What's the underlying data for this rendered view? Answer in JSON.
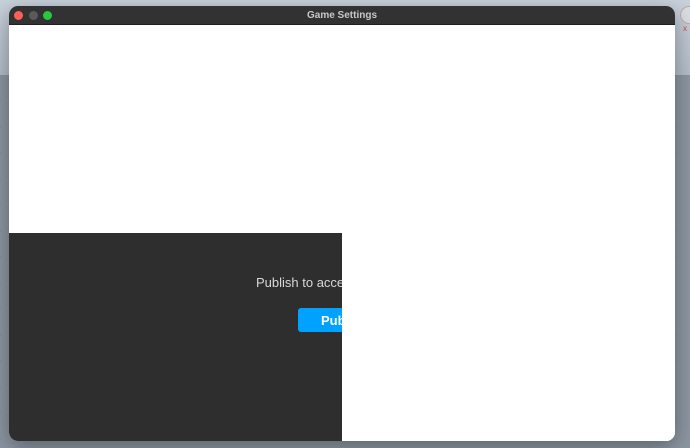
{
  "window": {
    "title": "Game Settings"
  },
  "publish_panel": {
    "message": "Publish to access",
    "button_label": "Pub"
  },
  "backdrop": {
    "edge_mark": "x"
  },
  "colors": {
    "titlebar": "#323232",
    "panel": "#2e2e2e",
    "accent": "#00a2ff",
    "close": "#ff5f57",
    "minimize": "#5a5a5a",
    "maximize": "#28c840"
  }
}
